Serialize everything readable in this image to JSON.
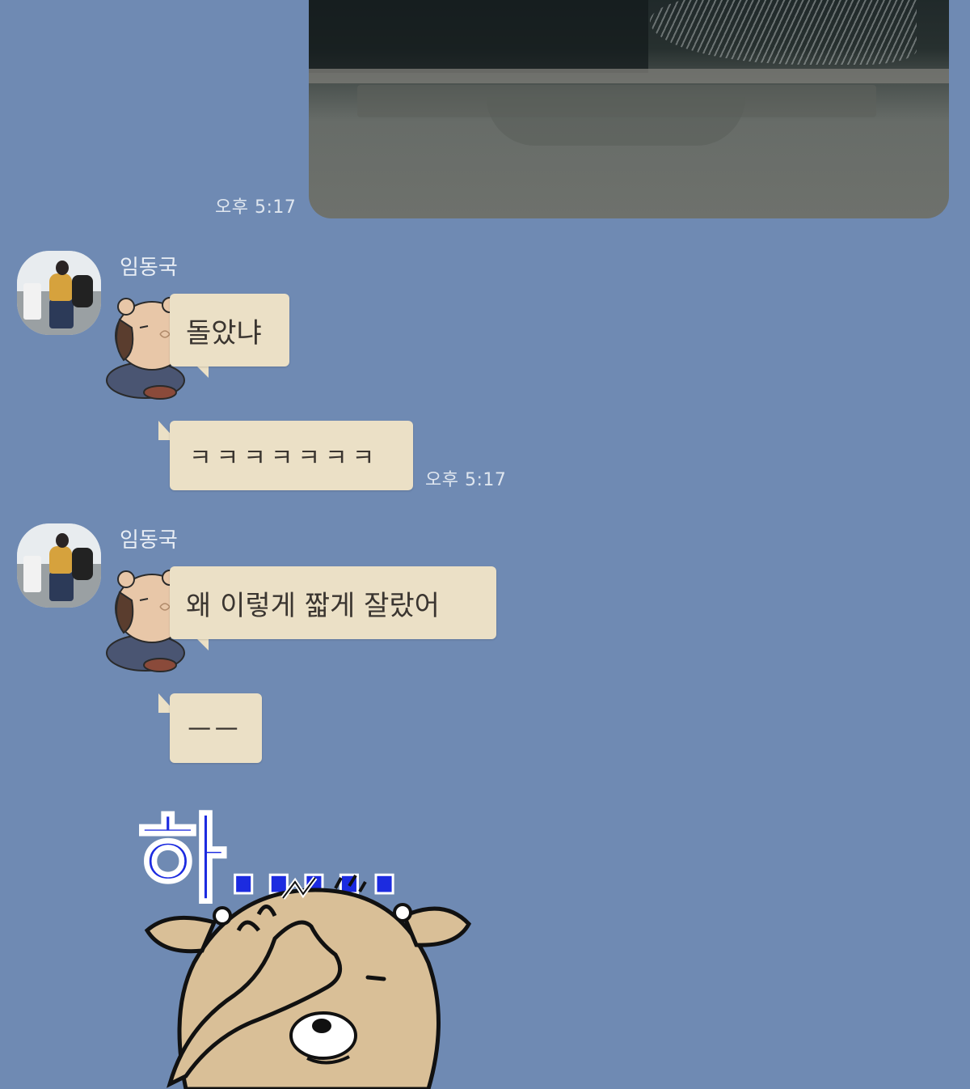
{
  "messages": [
    {
      "type": "photo",
      "sender": "me",
      "time": "오후 5:17"
    },
    {
      "type": "text",
      "sender": "임동국",
      "text": "돌았냐"
    },
    {
      "type": "text",
      "sender": "임동국",
      "text": "ㅋㅋㅋㅋㅋㅋㅋ",
      "time": "오후 5:17"
    },
    {
      "type": "text",
      "sender": "임동국",
      "text": "왜 이렇게 짧게 잘랐어"
    },
    {
      "type": "text",
      "sender": "임동국",
      "text": "ㅡㅡ"
    },
    {
      "type": "sticker",
      "sender": "임동국",
      "text": "하....."
    }
  ],
  "sender_name": "임동국",
  "colors": {
    "background": "#6f8ab3",
    "bubble": "#ebe0c6",
    "sticker_text": "#1c2be0"
  }
}
